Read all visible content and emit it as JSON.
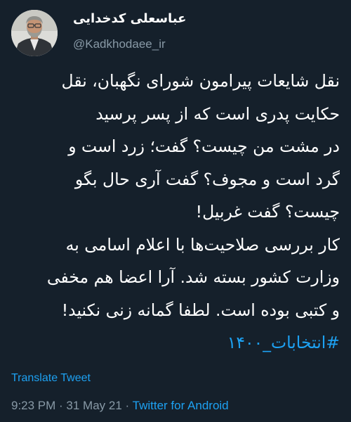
{
  "author": {
    "display_name": "عباسعلی کدخدایی",
    "handle": "@Kadkhodaee_ir"
  },
  "tweet": {
    "lines": [
      "نقل شایعات پیرامون شورای نگهبان، نقل",
      "حکایت پدری است که از پسر پرسید",
      "در مشت من چیست؟ گفت؛ زرد است و",
      "گرد است و مجوف؟ گفت آری حال بگو",
      "چیست؟ گفت غربیل!",
      "کار بررسی صلاحیت‌ها با اعلام اسامی به",
      "وزارت کشور بسته شد. آرا اعضا هم مخفی",
      "و کتبی بوده است. لطفا گمانه زنی نکنید!"
    ],
    "hashtag": "#انتخابات_۱۴۰۰",
    "translate_label": "Translate Tweet",
    "time": "9:23 PM",
    "separator": " · ",
    "date": "31 May 21",
    "source": "Twitter for Android"
  },
  "colors": {
    "background": "#15202b",
    "text": "#ffffff",
    "secondary": "#8899a6",
    "link": "#1da1f2"
  }
}
